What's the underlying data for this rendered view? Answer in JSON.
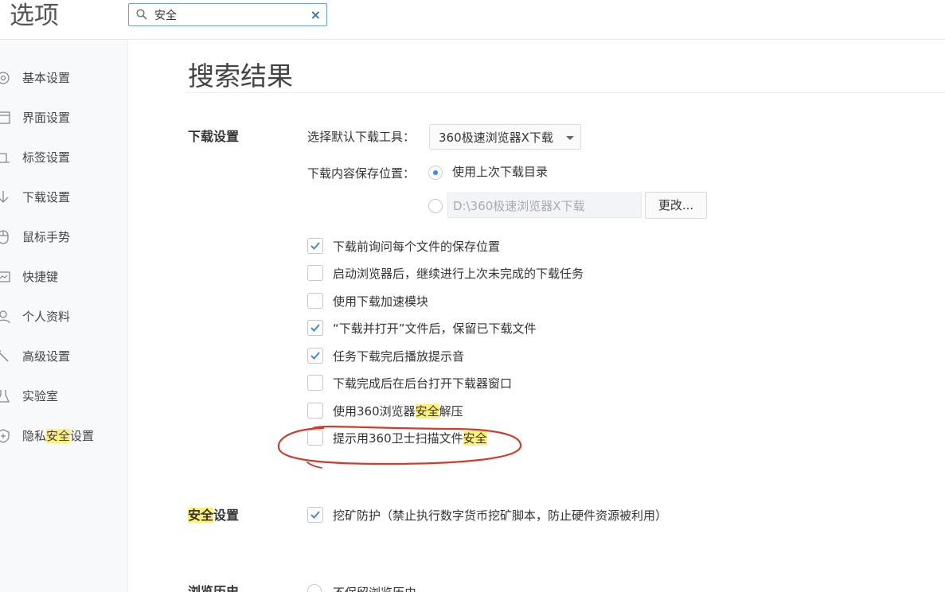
{
  "app": {
    "title": "选项"
  },
  "search": {
    "value": "安全",
    "clear": "×"
  },
  "sidebar": {
    "items": [
      {
        "label": "基本设置"
      },
      {
        "label": "界面设置"
      },
      {
        "label": "标签设置"
      },
      {
        "label": "下载设置"
      },
      {
        "label": "鼠标手势"
      },
      {
        "label": "快捷键"
      },
      {
        "label": "个人资料"
      },
      {
        "label": "高级设置"
      },
      {
        "label": "实验室"
      },
      {
        "label_pre": "隐私",
        "label_hl": "安全",
        "label_post": "设置"
      }
    ]
  },
  "main": {
    "title": "搜索结果",
    "download": {
      "section_title": "下载设置",
      "tool_label": "选择默认下载工具：",
      "tool_value": "360极速浏览器X下载",
      "location_label": "下载内容保存位置：",
      "radio_last_dir": "使用上次下载目录",
      "path_value": "D:\\360极速浏览器X下载",
      "change_button": "更改...",
      "options": [
        {
          "text": "下载前询问每个文件的保存位置",
          "checked": true
        },
        {
          "text": "启动浏览器后，继续进行上次未完成的下载任务",
          "checked": false
        },
        {
          "text": "使用下载加速模块",
          "checked": false
        },
        {
          "text": "“下载并打开”文件后，保留已下载文件",
          "checked": true
        },
        {
          "text": "任务下载完后播放提示音",
          "checked": true
        },
        {
          "text": "下载完成后在后台打开下载器窗口",
          "checked": false
        },
        {
          "text_pre": "使用360浏览器",
          "text_hl": "安全",
          "text_post": "解压",
          "checked": false
        },
        {
          "text_pre": "提示用360卫士扫描文件",
          "text_hl": "安全",
          "text_post": "",
          "checked": false
        }
      ]
    },
    "security": {
      "title_hl": "安全",
      "title_post": "设置",
      "option": "挖矿防护（禁止执行数字货币挖矿脚本，防止硬件资源被利用）",
      "checked": true
    },
    "history": {
      "section_title": "浏览历史",
      "option": "不保留浏览历史"
    }
  },
  "colors": {
    "accent": "#3f8ae8",
    "highlight": "#fff176",
    "annotation": "#d33a2c"
  }
}
